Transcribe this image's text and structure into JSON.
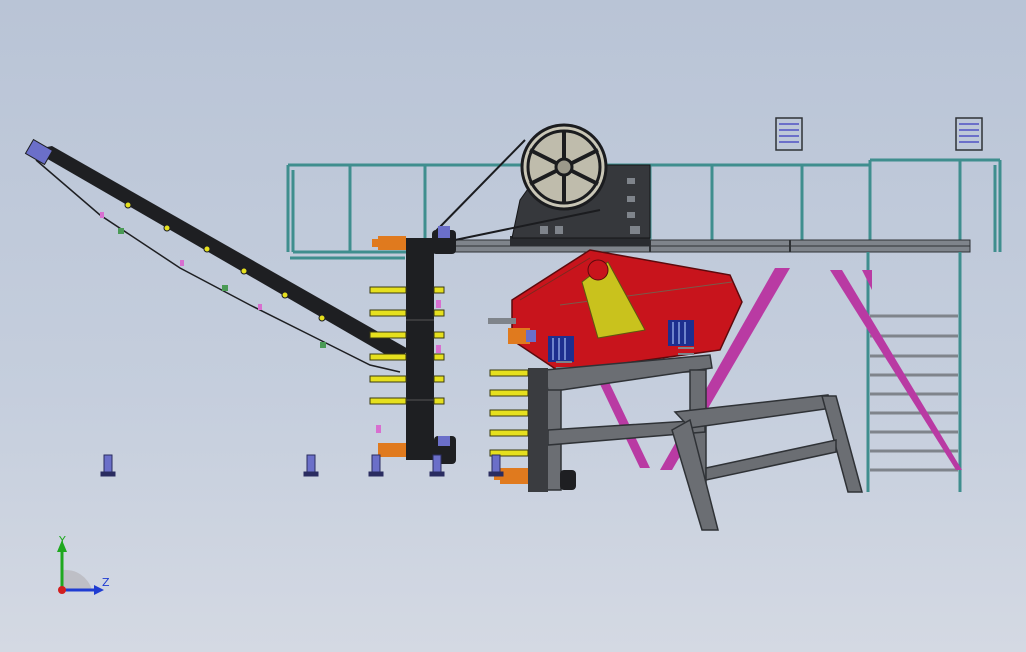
{
  "colors": {
    "background_top": "#b9c4d6",
    "background_bottom": "#d4d9e3",
    "frame_gray": "#5a5d62",
    "belt_black": "#1e1f22",
    "screen_red": "#c8141c",
    "yellow_plate": "#c9c21d",
    "magenta_brace": "#b93aa3",
    "teal_rail": "#3f8e8e",
    "motor_orange": "#e07a1e",
    "motor_blue": "#6b6fc9",
    "spring_blue": "#1d2f8f",
    "idler_yellow": "#e6e01e",
    "triad_x": "#d21f1f",
    "triad_y": "#1fa81f",
    "triad_z": "#1f3cd2"
  },
  "triad": {
    "y_label": "Y",
    "z_label": "Z"
  },
  "icons": {
    "triad": "coordinate-triad-icon"
  }
}
